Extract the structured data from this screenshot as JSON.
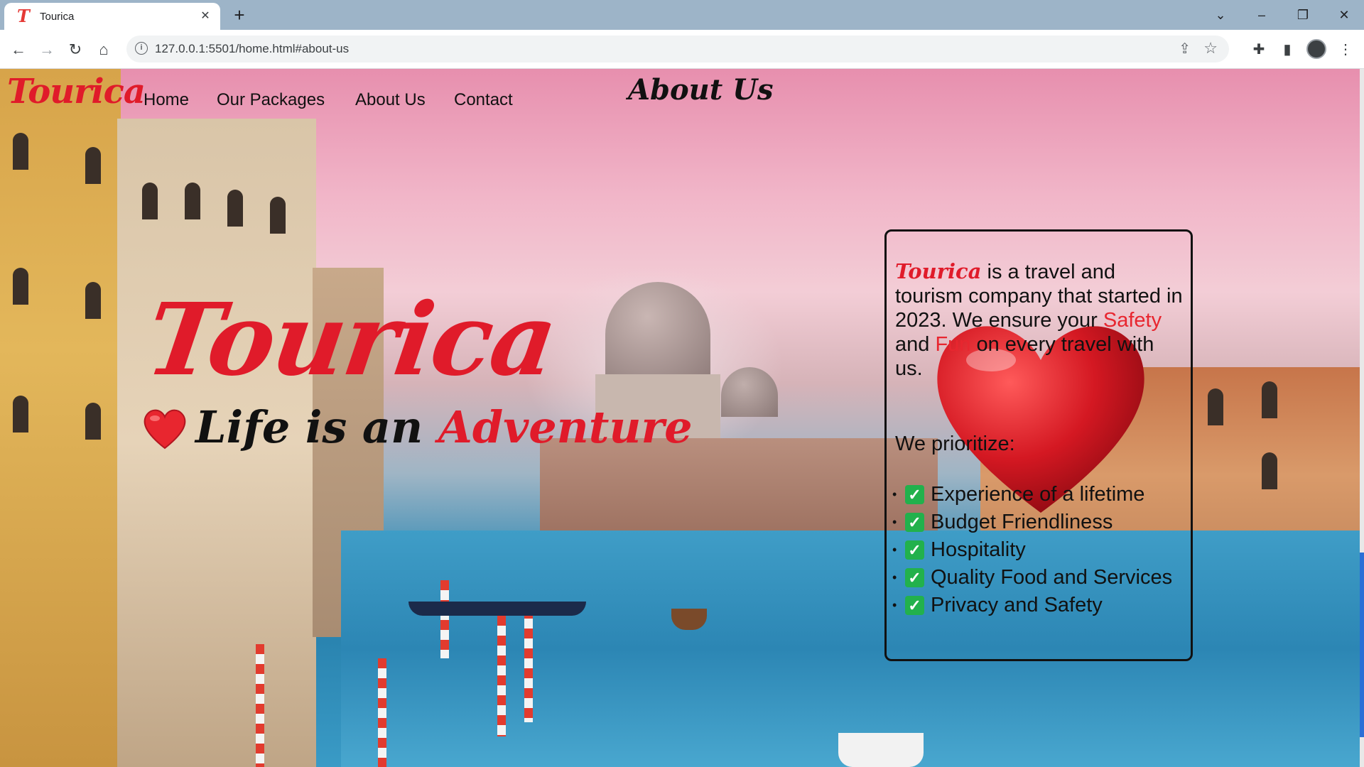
{
  "browser": {
    "tab": {
      "title": "Tourica",
      "favicon_letter": "T",
      "close": "✕"
    },
    "new_tab": "+",
    "window_controls": {
      "dropdown": "⌄",
      "minimize": "–",
      "restore": "❐",
      "close": "✕"
    },
    "toolbar": {
      "back": "←",
      "forward": "→",
      "reload": "↻",
      "home": "⌂"
    },
    "address_bar": {
      "url": "127.0.0.1:5501/home.html#about-us",
      "info_icon": "i"
    },
    "icons": [
      "share-icon",
      "star-icon",
      "extensions-icon",
      "sidebar-icon",
      "profile-avatar",
      "menu-icon"
    ]
  },
  "site": {
    "logo": "Tourica",
    "nav": [
      {
        "label": "Home"
      },
      {
        "label": "Our Packages"
      },
      {
        "label": "About Us"
      },
      {
        "label": "Contact"
      }
    ],
    "section_title": "About Us"
  },
  "hero": {
    "title": "Tourica",
    "tagline_start": "Life is an ",
    "tagline_accent": "Adventure",
    "heart_icon": "heart-icon"
  },
  "about": {
    "brand": "Tourica",
    "text_1": " is a travel and tourism company that started in 2023. We ensure your ",
    "safety": "Safety",
    "text_2": " and ",
    "fun": "Fun",
    "text_3": " on every travel with us.",
    "prioritize_label": "We prioritize:",
    "priorities": [
      "Experience of a lifetime",
      "Budget Friendliness",
      "Hospitality",
      "Quality Food and Services",
      "Privacy and Safety"
    ]
  },
  "colors": {
    "brand_red": "#e01b2a",
    "check_green": "#22b14c"
  }
}
